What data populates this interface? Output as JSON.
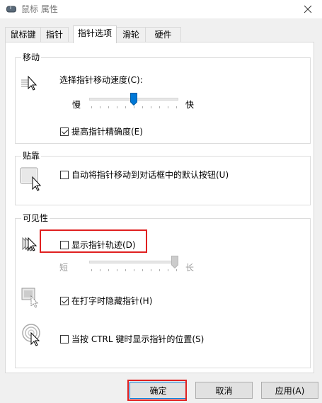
{
  "window": {
    "title": "鼠标 属性",
    "icon": "mouse-icon",
    "close_icon": "close-icon"
  },
  "tabs": [
    {
      "label": "鼠标键",
      "active": false
    },
    {
      "label": "指针",
      "active": false
    },
    {
      "label": "指针选项",
      "active": true
    },
    {
      "label": "滑轮",
      "active": false
    },
    {
      "label": "硬件",
      "active": false
    }
  ],
  "motion": {
    "title": "移动",
    "speed_label": "选择指针移动速度(C):",
    "slow_label": "慢",
    "fast_label": "快",
    "speed_value_fraction": 0.5,
    "precision_label": "提高指针精确度(E)",
    "precision_checked": true
  },
  "snap": {
    "title": "贴靠",
    "snap_label": "自动将指针移动到对话框中的默认按钮(U)",
    "snap_checked": false
  },
  "visibility": {
    "title": "可见性",
    "trails_label": "显示指针轨迹(D)",
    "trails_checked": false,
    "short_label": "短",
    "long_label": "长",
    "trails_value_fraction": 1.0,
    "hide_typing_label": "在打字时隐藏指针(H)",
    "hide_typing_checked": true,
    "ctrl_label": "当按 CTRL 键时显示指针的位置(S)",
    "ctrl_checked": false
  },
  "buttons": {
    "ok": "确定",
    "cancel": "取消",
    "apply": "应用(A)"
  },
  "colors": {
    "highlight": "#e02020",
    "accent": "#0078d7"
  }
}
